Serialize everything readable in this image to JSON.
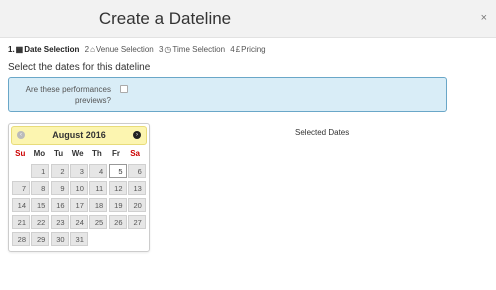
{
  "header": {
    "title": "Create a Dateline",
    "close_icon": "×"
  },
  "steps": [
    {
      "num": "1.",
      "icon": "calendar-icon",
      "glyph": "▦",
      "label": "Date Selection",
      "active": true
    },
    {
      "num": "2",
      "icon": "home-icon",
      "glyph": "⌂",
      "label": "Venue Selection",
      "active": false
    },
    {
      "num": "3",
      "icon": "clock-icon",
      "glyph": "◷",
      "label": "Time Selection",
      "active": false
    },
    {
      "num": "4",
      "icon": "pound-icon",
      "glyph": "£",
      "label": "Pricing",
      "active": false
    }
  ],
  "subtitle": "Select the dates for this dateline",
  "previews": {
    "label": "Are these performances previews?",
    "checked": false
  },
  "calendar": {
    "month_label": "August 2016",
    "prev_icon": "‹",
    "next_icon": "›",
    "weekdays": [
      "Su",
      "Mo",
      "Tu",
      "We",
      "Th",
      "Fr",
      "Sa"
    ],
    "weeks": [
      [
        "",
        "1",
        "2",
        "3",
        "4",
        "5",
        "6"
      ],
      [
        "7",
        "8",
        "9",
        "10",
        "11",
        "12",
        "13"
      ],
      [
        "14",
        "15",
        "16",
        "17",
        "18",
        "19",
        "20"
      ],
      [
        "21",
        "22",
        "23",
        "24",
        "25",
        "26",
        "27"
      ],
      [
        "28",
        "29",
        "30",
        "31",
        "",
        "",
        ""
      ]
    ],
    "selected_day": "5"
  },
  "selected_dates_label": "Selected Dates",
  "colors": {
    "info_bg": "#d9edf7",
    "info_border": "#6aa7c8",
    "cal_header_bg": "#fcf5b0",
    "weekend_red": "#cc0000"
  }
}
